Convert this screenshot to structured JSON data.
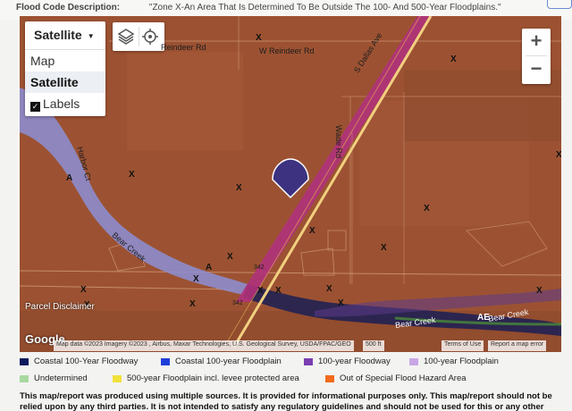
{
  "header": {
    "title": "Flood Code Description:",
    "description": "\"Zone X-An Area That Is Determined To Be Outside The 100- And 500-Year Floodplains.\""
  },
  "map_controls": {
    "maptype_selected": "Satellite",
    "options": [
      "Map",
      "Satellite"
    ],
    "labels_option": "Labels",
    "labels_checked": true,
    "zoom_in": "+",
    "zoom_out": "−"
  },
  "map_labels": {
    "roads": [
      "Reindeer Rd",
      "W Reindeer Rd",
      "S Dallas Ave",
      "Wade Rd",
      "Harbor Ct"
    ],
    "creeks": [
      "Bear Creek",
      "Bear Creek",
      "Bear Creek"
    ],
    "highway": "342",
    "zone_x": "X",
    "zone_a": "A",
    "zone_ae": "AE"
  },
  "parcel_disclaimer": "Parcel Disclaimer",
  "google_logo": "Google",
  "attribution": {
    "map_data": "Map data ©2023 Imagery ©2023 , Airbus, Maxar Technologies, U.S. Geological Survey, USDA/FPAC/GEO",
    "scale": "500 ft",
    "terms": "Terms of Use",
    "report": "Report a map error"
  },
  "legend": [
    {
      "label": "Coastal 100-Year Floodway",
      "color": "#0a1a5c"
    },
    {
      "label": "Coastal 100-year Floodplain",
      "color": "#1f3fd9"
    },
    {
      "label": "100-year Floodway",
      "color": "#7a3fb0"
    },
    {
      "label": "100-year Floodplain",
      "color": "#c9a7e6"
    },
    {
      "label": "Undetermined",
      "color": "#a8d9a0"
    },
    {
      "label": "500-year Floodplain incl. levee protected area",
      "color": "#f2e23a"
    },
    {
      "label": "Out of Special Flood Hazard Area",
      "color": "#f26a1b"
    }
  ],
  "disclaimer": "This map/report was produced using multiple sources. It is provided for informational purposes only. This map/report should not be relied upon by any third parties. It is not intended to satisfy any regulatory guidelines and should not be used for this or any other",
  "colors": {
    "map_tint": "#9e5333",
    "floodway_pink": "#b0327a",
    "floodplain_lavender": "#8c8fd6",
    "creek_dark": "#1a1f55"
  }
}
